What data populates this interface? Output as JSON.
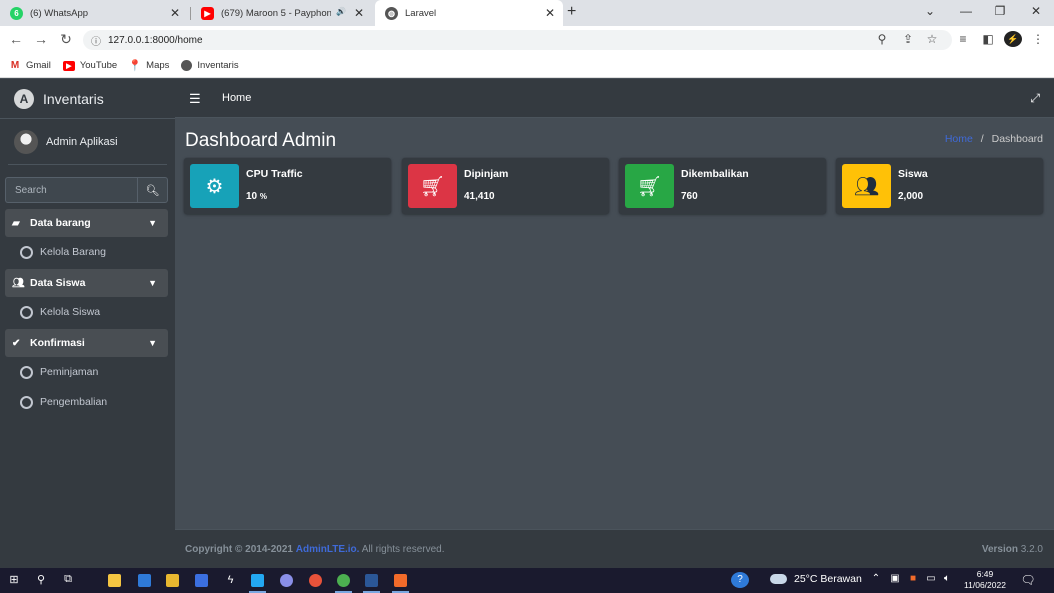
{
  "browser": {
    "tabs": [
      {
        "title": "(6) WhatsApp",
        "favicon": "whatsapp-icon",
        "badge": "6",
        "color": "#25d366"
      },
      {
        "title": "(679) Maroon 5 - Payphone",
        "favicon": "youtube-icon",
        "color": "#ff0000",
        "audio": "🔊"
      },
      {
        "title": "Laravel",
        "favicon": "globe-icon",
        "color": "#555555"
      }
    ],
    "url": "127.0.0.1:8000/home",
    "bookmarks": [
      {
        "label": "Gmail",
        "icon": "gmail-icon"
      },
      {
        "label": "YouTube",
        "icon": "youtube-icon"
      },
      {
        "label": "Maps",
        "icon": "maps-icon"
      },
      {
        "label": "Inventaris",
        "icon": "globe-icon"
      }
    ]
  },
  "sidebar": {
    "brand": "Inventaris",
    "user": "Admin Aplikasi",
    "search_placeholder": "Search",
    "menus": [
      {
        "label": "Data barang",
        "icon": "box-icon",
        "items": [
          "Kelola Barang"
        ]
      },
      {
        "label": "Data Siswa",
        "icon": "users-icon",
        "items": [
          "Kelola Siswa"
        ]
      },
      {
        "label": "Konfirmasi",
        "icon": "check-double-icon",
        "items": [
          "Peminjaman",
          "Pengembalian"
        ]
      }
    ]
  },
  "topnav": {
    "home": "Home"
  },
  "page": {
    "title": "Dashboard Admin",
    "breadcrumb": {
      "home": "Home",
      "sep": "/",
      "current": "Dashboard"
    }
  },
  "info_boxes": [
    {
      "label": "CPU Traffic",
      "value": "10",
      "unit": "%",
      "icon": "gear-icon",
      "color": "#17a2b8"
    },
    {
      "label": "Dipinjam",
      "value": "41,410",
      "icon": "cart-icon",
      "color": "#dc3545"
    },
    {
      "label": "Dikembalikan",
      "value": "760",
      "icon": "cart-icon",
      "color": "#28a745"
    },
    {
      "label": "Siswa",
      "value": "2,000",
      "icon": "users-icon",
      "color": "#ffc107"
    }
  ],
  "footer": {
    "copyright": "Copyright © 2014-2021",
    "brand_link": "AdminLTE.io.",
    "rights": "All rights reserved.",
    "version_label": "Version",
    "version": "3.2.0"
  },
  "taskbar": {
    "weather": "25°C Berawan",
    "time": "6:49",
    "date": "11/06/2022"
  }
}
